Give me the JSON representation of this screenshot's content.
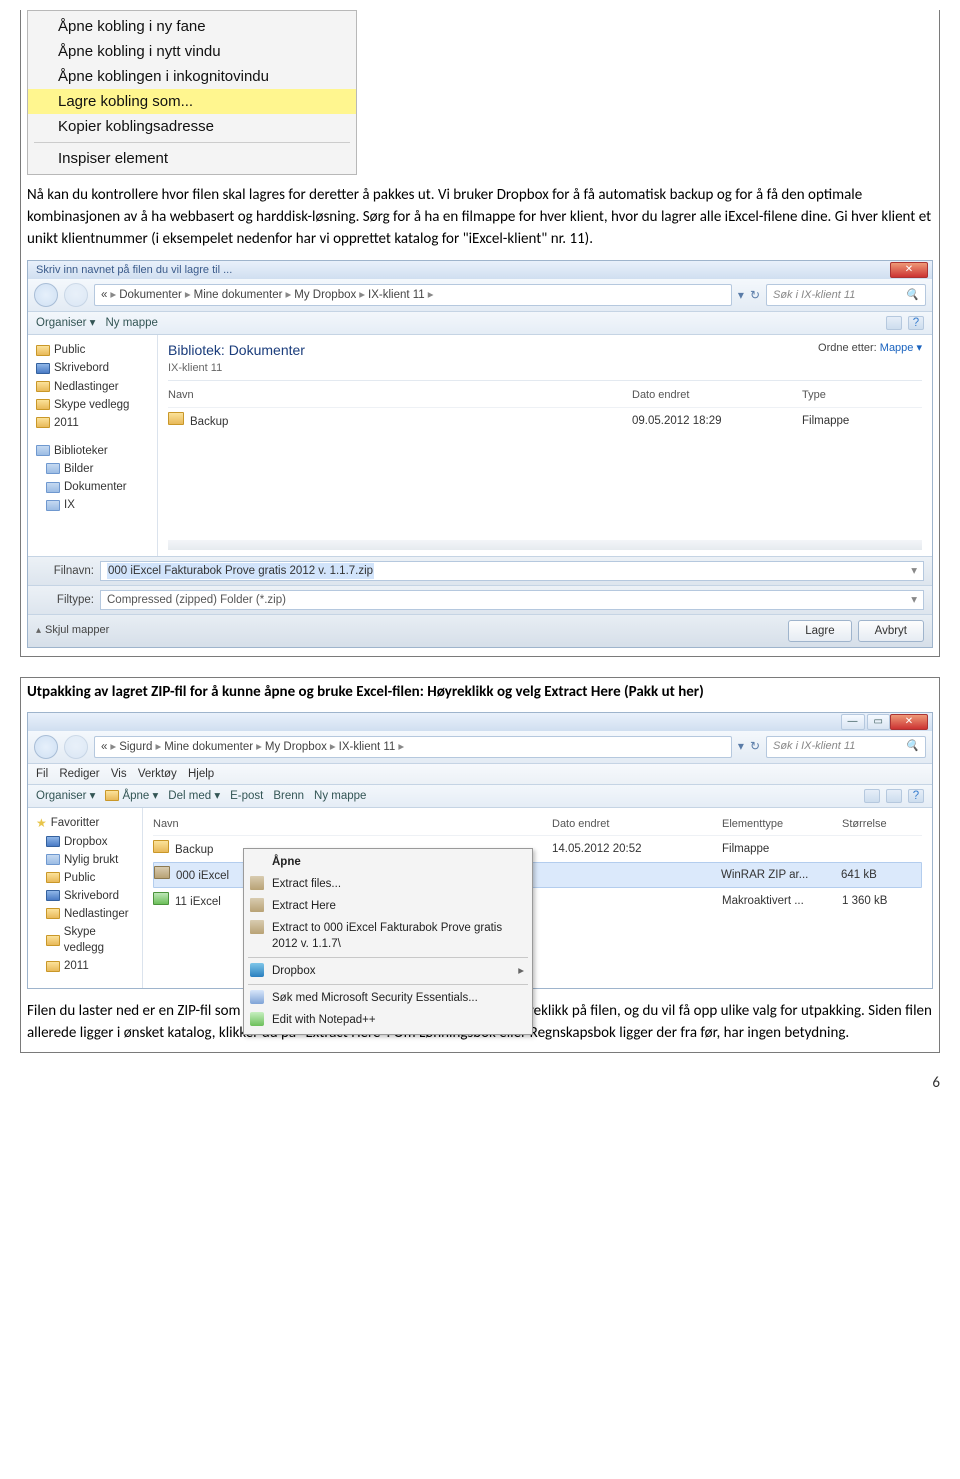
{
  "page_number": "6",
  "context_menu": {
    "items": [
      "Åpne kobling i ny fane",
      "Åpne kobling i nytt vindu",
      "Åpne koblingen i inkognitovindu",
      "Lagre kobling som...",
      "Kopier koblingsadresse",
      "Inspiser element"
    ]
  },
  "para1": "Nå kan du kontrollere hvor filen skal lagres for deretter å pakkes ut. Vi bruker Dropbox for å få automatisk backup og for å få den optimale kombinasjonen av å ha webbasert og harddisk-løsning. Sørg for å ha en filmappe for hver klient, hvor du lagrer alle iExcel-filene dine. Gi hver klient et unikt klientnummer (i eksempelet nedenfor har vi opprettet katalog for \"iExcel-klient\" nr. 11).",
  "save_dialog": {
    "title": "Skriv inn navnet på filen du vil lagre til ...",
    "breadcrumb": [
      "«",
      "Dokumenter",
      "Mine dokumenter",
      "My Dropbox",
      "IX-klient 11"
    ],
    "search_placeholder": "Søk i IX-klient 11",
    "toolbar": {
      "organiser": "Organiser ▾",
      "nymappe": "Ny mappe"
    },
    "tree": {
      "top": [
        "Public",
        "Skrivebord",
        "Nedlastinger",
        "Skype vedlegg",
        "2011"
      ],
      "libs_header": "Biblioteker",
      "libs": [
        "Bilder",
        "Dokumenter",
        "IX"
      ]
    },
    "library": {
      "title": "Bibliotek: Dokumenter",
      "sub": "IX-klient 11",
      "sort_label": "Ordne etter:",
      "sort_value": "Mappe ▾"
    },
    "columns": {
      "name": "Navn",
      "date": "Dato endret",
      "type": "Type"
    },
    "rows": [
      {
        "name": "Backup",
        "date": "09.05.2012 18:29",
        "type": "Filmappe",
        "kind": "folder"
      }
    ],
    "filename_label": "Filnavn:",
    "filename_value": "000 iExcel Fakturabok Prove gratis 2012 v. 1.1.7.zip",
    "filetype_label": "Filtype:",
    "filetype_value": "Compressed (zipped) Folder (*.zip)",
    "hide_folders": "Skjul mapper",
    "save_btn": "Lagre",
    "cancel_btn": "Avbryt"
  },
  "heading2": "Utpakking av lagret ZIP-fil for å kunne åpne og bruke Excel-filen: Høyreklikk og velg Extract Here (Pakk ut her)",
  "explorer": {
    "breadcrumb": [
      "«",
      "Sigurd",
      "Mine dokumenter",
      "My Dropbox",
      "IX-klient 11"
    ],
    "search_placeholder": "Søk i IX-klient 11",
    "menubar": [
      "Fil",
      "Rediger",
      "Vis",
      "Verktøy",
      "Hjelp"
    ],
    "toolbar": {
      "organiser": "Organiser ▾",
      "apne": "Åpne ▾",
      "delmed": "Del med ▾",
      "epost": "E-post",
      "brenn": "Brenn",
      "nymappe": "Ny mappe"
    },
    "tree": {
      "fav_header": "Favoritter",
      "items": [
        "Dropbox",
        "Nylig brukt",
        "Public",
        "Skrivebord",
        "Nedlastinger",
        "Skype vedlegg",
        "2011"
      ]
    },
    "columns": {
      "name": "Navn",
      "date": "Dato endret",
      "type": "Elementtype",
      "size": "Størrelse"
    },
    "rows": [
      {
        "name": "Backup",
        "date": "14.05.2012 20:52",
        "type": "Filmappe",
        "size": "",
        "kind": "folder",
        "sel": false
      },
      {
        "name": "000 iExcel",
        "date": "",
        "type": "WinRAR ZIP ar...",
        "size": "641 kB",
        "kind": "zip",
        "sel": true
      },
      {
        "name": "11 iExcel",
        "date": "",
        "type": "Makroaktivert ...",
        "size": "1 360 kB",
        "kind": "xls",
        "sel": false
      }
    ],
    "ctx": [
      {
        "label": "Åpne",
        "bold": true,
        "icon": ""
      },
      {
        "label": "Extract files...",
        "icon": "open"
      },
      {
        "label": "Extract Here",
        "icon": "open"
      },
      {
        "label": "Extract to 000 iExcel Fakturabok Prove gratis 2012 v. 1.1.7\\",
        "icon": "open"
      },
      {
        "sep": true
      },
      {
        "label": "Dropbox",
        "icon": "db"
      },
      {
        "sep": true
      },
      {
        "label": "Søk med Microsoft Security Essentials...",
        "icon": "mse"
      },
      {
        "label": "Edit with Notepad++",
        "icon": "np"
      }
    ]
  },
  "para2": "Filen du laster ned er en ZIP-fil som må pakkes ut før det er mulig å bruke den. Høyreklikk på filen, og du vil få opp ulike valg for utpakking. Siden filen allerede ligger i ønsket katalog, klikker du på \"Extract Here\".  Om Lønningsbok eller Regnskapsbok ligger der fra før, har ingen betydning."
}
